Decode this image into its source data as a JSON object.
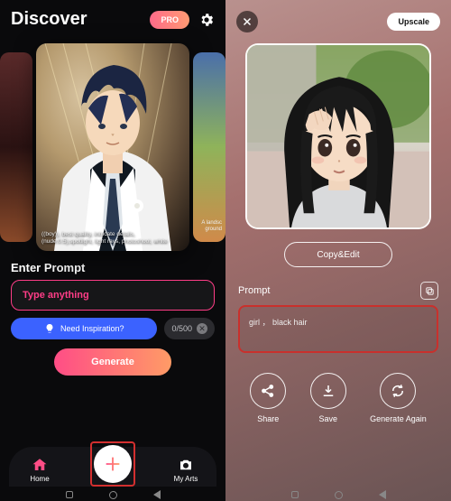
{
  "left": {
    "title": "Discover",
    "pro_label": "PRO",
    "card_caption": "((boy)), best quality, intricate details, (nude:0.5),spotlight, light rays, photoshoot, white",
    "side_caption": "A landsc\nground",
    "enter_prompt_label": "Enter Prompt",
    "prompt_placeholder": "Type anything",
    "inspire_label": "Need Inspiration?",
    "counter": "0/500",
    "generate_label": "Generate",
    "nav": {
      "home": "Home",
      "my_arts": "My Arts"
    }
  },
  "right": {
    "upscale_label": "Upscale",
    "copy_edit_label": "Copy&Edit",
    "prompt_section_title": "Prompt",
    "prompt_text": "girl ， black hair",
    "actions": {
      "share": "Share",
      "save": "Save",
      "regen": "Generate Again"
    }
  }
}
